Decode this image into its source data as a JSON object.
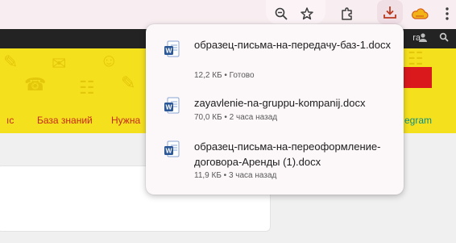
{
  "toolbar": {
    "zoom_icon": "zoom-out-icon",
    "bookmark_icon": "star-icon",
    "extensions_icon": "puzzle-icon",
    "downloads_icon": "download-icon",
    "profile_icon": "cloud-icon",
    "menu_icon": "kebab-menu-icon"
  },
  "site": {
    "header_text": "ra",
    "nav": {
      "item1": "ıс",
      "item2": "База знаний",
      "item3": "Нужна",
      "item4": "egram"
    }
  },
  "downloads": [
    {
      "name": "образец-письма-на-передачу-баз-1.docx",
      "meta": "12,2 КБ • Готово"
    },
    {
      "name": "zayavlenie-na-gruppu-kompanij.docx",
      "meta": "70,0 КБ • 2 часа назад"
    },
    {
      "name": "образец-письма-на-переоформление-договора-Аренды (1).docx",
      "meta": "11,9 КБ • 3 часа назад"
    }
  ],
  "colors": {
    "accent_yellow": "#f5e01e",
    "nav_red": "#c62a1d",
    "word_blue": "#2b5797"
  }
}
